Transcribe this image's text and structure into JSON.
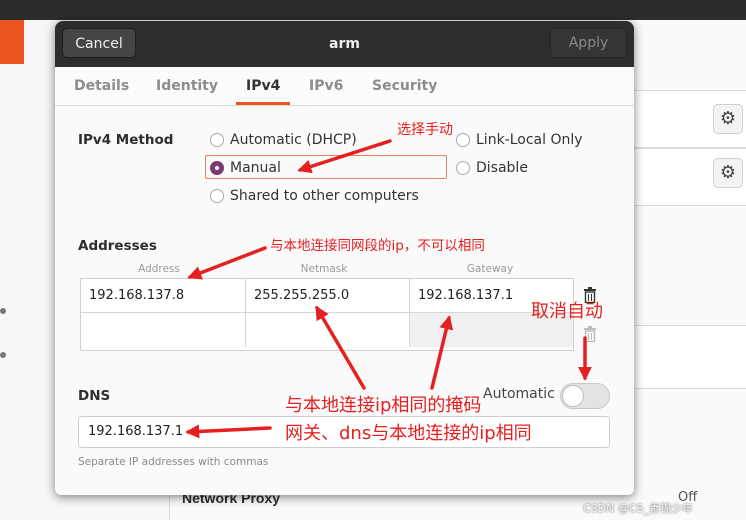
{
  "window": {
    "title": "arm",
    "cancel_label": "Cancel",
    "apply_label": "Apply"
  },
  "tabs": [
    {
      "label": "Details"
    },
    {
      "label": "Identity"
    },
    {
      "label": "IPv4",
      "active": true
    },
    {
      "label": "IPv6"
    },
    {
      "label": "Security"
    }
  ],
  "ipv4": {
    "method_label": "IPv4 Method",
    "methods": {
      "automatic": "Automatic (DHCP)",
      "link_local": "Link-Local Only",
      "manual": "Manual",
      "disable": "Disable",
      "shared": "Shared to other computers"
    },
    "selected_method": "Manual"
  },
  "addresses": {
    "label": "Addresses",
    "columns": [
      "Address",
      "Netmask",
      "Gateway"
    ],
    "rows": [
      [
        "192.168.137.8",
        "255.255.255.0",
        "192.168.137.1"
      ],
      [
        "",
        "",
        ""
      ]
    ]
  },
  "dns": {
    "label": "DNS",
    "automatic_label": "Automatic",
    "automatic_on": false,
    "value": "192.168.137.1",
    "hint": "Separate IP addresses with commas"
  },
  "background": {
    "network_proxy": "Network Proxy",
    "proxy_state": "Off"
  },
  "annotations": {
    "select_manual": "选择手动",
    "address_note": "与本地连接同网段的ip，不可以相同",
    "cancel_auto": "取消自动",
    "mask_note": "与本地连接ip相同的掩码",
    "gateway_dns_note": "网关、dns与本地连接的ip相同"
  },
  "watermark": "CSDN @CS_素锦少年",
  "colors": {
    "accent": "#e95420",
    "radio_selected": "#7a3a74",
    "annotation": "#e6201f",
    "header": "#2d2d2d"
  }
}
